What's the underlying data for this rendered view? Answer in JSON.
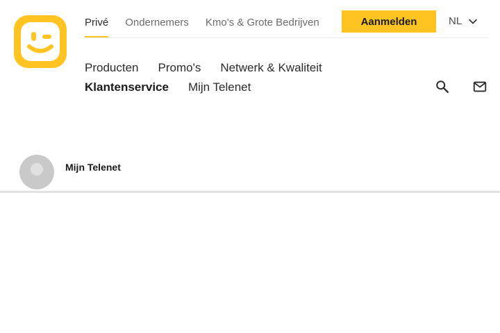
{
  "brand": {
    "logo": "telenet-smiley-logo",
    "accent_color": "#ffc421"
  },
  "top_nav": {
    "items": [
      {
        "label": "Privé",
        "active": true
      },
      {
        "label": "Ondernemers",
        "active": false
      },
      {
        "label": "Kmo's & Grote Bedrijven",
        "active": false
      }
    ],
    "login_label": "Aanmelden",
    "language": "NL"
  },
  "main_nav": {
    "row1": [
      {
        "label": "Producten"
      },
      {
        "label": "Promo's"
      },
      {
        "label": "Netwerk & Kwaliteit"
      }
    ],
    "row2": [
      {
        "label": "Klantenservice",
        "active": true
      },
      {
        "label": "Mijn Telenet",
        "active": false
      }
    ],
    "icons": [
      "search-icon",
      "mail-icon"
    ]
  },
  "breadcrumb": {
    "avatar": "avatar",
    "label": "Mijn Telenet"
  }
}
